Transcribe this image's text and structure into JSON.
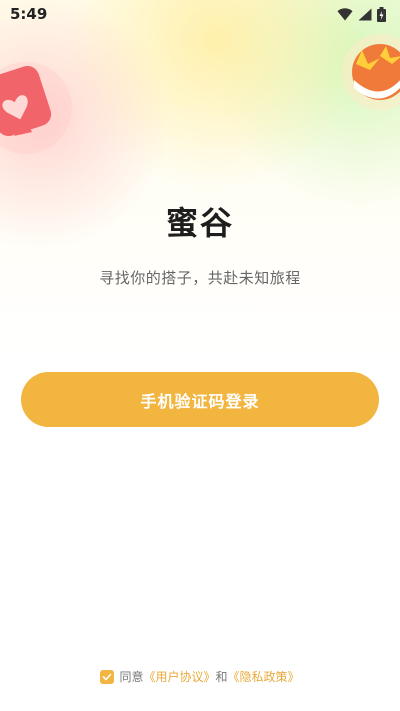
{
  "status_bar": {
    "time": "5:49",
    "icons": [
      "wifi-icon",
      "signal-icon",
      "battery-icon"
    ]
  },
  "app": {
    "title": "蜜谷",
    "slogan": "寻找你的搭子，共赴未知旅程"
  },
  "login": {
    "phone_login_label": "手机验证码登录"
  },
  "agreement": {
    "checked": true,
    "prefix": "同意",
    "user_agreement": "《用户协议》",
    "conjunction": "和",
    "privacy_policy": "《隐私政策》"
  },
  "colors": {
    "accent": "#f2b53f",
    "link": "#e8a93a"
  }
}
